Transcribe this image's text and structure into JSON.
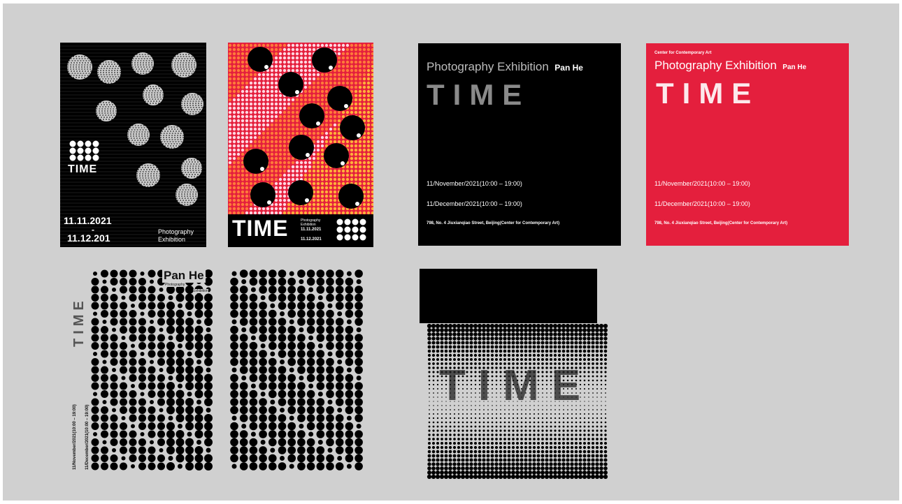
{
  "colors": {
    "canvas": "#d0d0d0",
    "poster_black": "#000000",
    "poster_red": "#e41f3d",
    "dot_pink": "#e8306a",
    "white": "#ffffff"
  },
  "poster1": {
    "title": "TIME",
    "date_start": "11.11.2021",
    "date_sep": "-",
    "date_end": "11.12.201",
    "label_line1": "Photography",
    "label_line2": "Exhibition"
  },
  "poster2": {
    "title": "TIME",
    "caption_line1": "Photography",
    "caption_line2": "Exhibition",
    "date_start": "11.11.2021",
    "date_end": "11.12.2021"
  },
  "poster3": {
    "heading": "Photography Exhibition",
    "artist": "Pan He",
    "title": "TIME",
    "date1": "11/November/2021(10:00 – 19:00)",
    "date2": "11/December/2021(10:00 – 19:00)",
    "address": "798, No. 4 Jiuxianqiao Street, Beijing(Center for Contemporary Art)"
  },
  "poster4": {
    "org": "Center for Contemporary Art",
    "heading": "Photography Exhibition",
    "artist": "Pan He",
    "title": "TIME",
    "date1": "11/November/2021(10:00 – 19:00)",
    "date2": "11/December/2021(10:00 – 19:00)",
    "address": "798, No. 4 Jiuxianqiao Street, Beijing(Center for Contemporary Art)"
  },
  "poster5": {
    "title": "TIME",
    "artist": "Pan He",
    "label_line1": "Photography",
    "label_line2": "Exhibition",
    "vertical_date1": "11/November/2021(10:00 – 19:00)",
    "vertical_date2": "11/December/2021(10:00 – 19:00)"
  },
  "poster7": {
    "title": "TIME"
  }
}
